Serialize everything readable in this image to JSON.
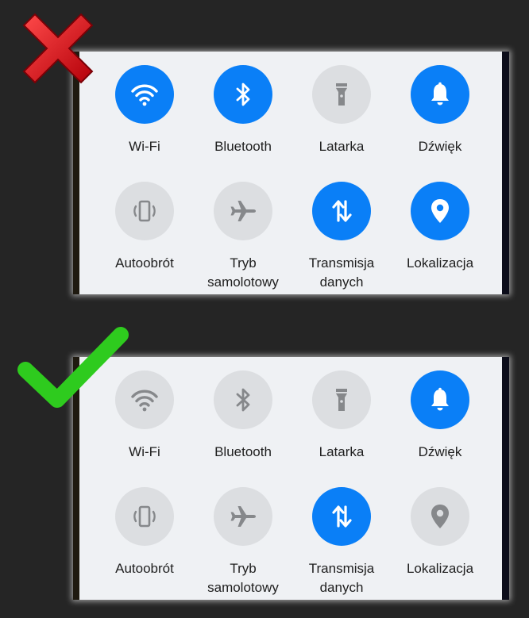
{
  "colors": {
    "background": "#252525",
    "panel": "#eff1f4",
    "tile_on": "#0a7ff7",
    "tile_off": "#dcdee1",
    "icon_off": "#86888b",
    "wrong_mark": "#e0131a",
    "correct_mark": "#2ecb1e"
  },
  "examples": [
    {
      "verdict": "wrong",
      "verdict_icon": "red-x-icon",
      "tiles": [
        {
          "label": "Wi-Fi",
          "icon": "wifi-icon",
          "active": true
        },
        {
          "label": "Bluetooth",
          "icon": "bluetooth-icon",
          "active": true
        },
        {
          "label": "Latarka",
          "icon": "flashlight-icon",
          "active": false
        },
        {
          "label": "Dźwięk",
          "icon": "bell-icon",
          "active": true
        },
        {
          "label": "Autoobrót",
          "icon": "auto-rotate-icon",
          "active": false
        },
        {
          "label": "Tryb\nsamolotowy",
          "icon": "airplane-icon",
          "active": false
        },
        {
          "label": "Transmisja\ndanych",
          "icon": "mobile-data-icon",
          "active": true
        },
        {
          "label": "Lokalizacja",
          "icon": "location-pin-icon",
          "active": true
        }
      ]
    },
    {
      "verdict": "correct",
      "verdict_icon": "green-check-icon",
      "tiles": [
        {
          "label": "Wi-Fi",
          "icon": "wifi-icon",
          "active": false
        },
        {
          "label": "Bluetooth",
          "icon": "bluetooth-icon",
          "active": false
        },
        {
          "label": "Latarka",
          "icon": "flashlight-icon",
          "active": false
        },
        {
          "label": "Dźwięk",
          "icon": "bell-icon",
          "active": true
        },
        {
          "label": "Autoobrót",
          "icon": "auto-rotate-icon",
          "active": false
        },
        {
          "label": "Tryb\nsamolotowy",
          "icon": "airplane-icon",
          "active": false
        },
        {
          "label": "Transmisja\ndanych",
          "icon": "mobile-data-icon",
          "active": true
        },
        {
          "label": "Lokalizacja",
          "icon": "location-pin-icon",
          "active": false
        }
      ]
    }
  ]
}
